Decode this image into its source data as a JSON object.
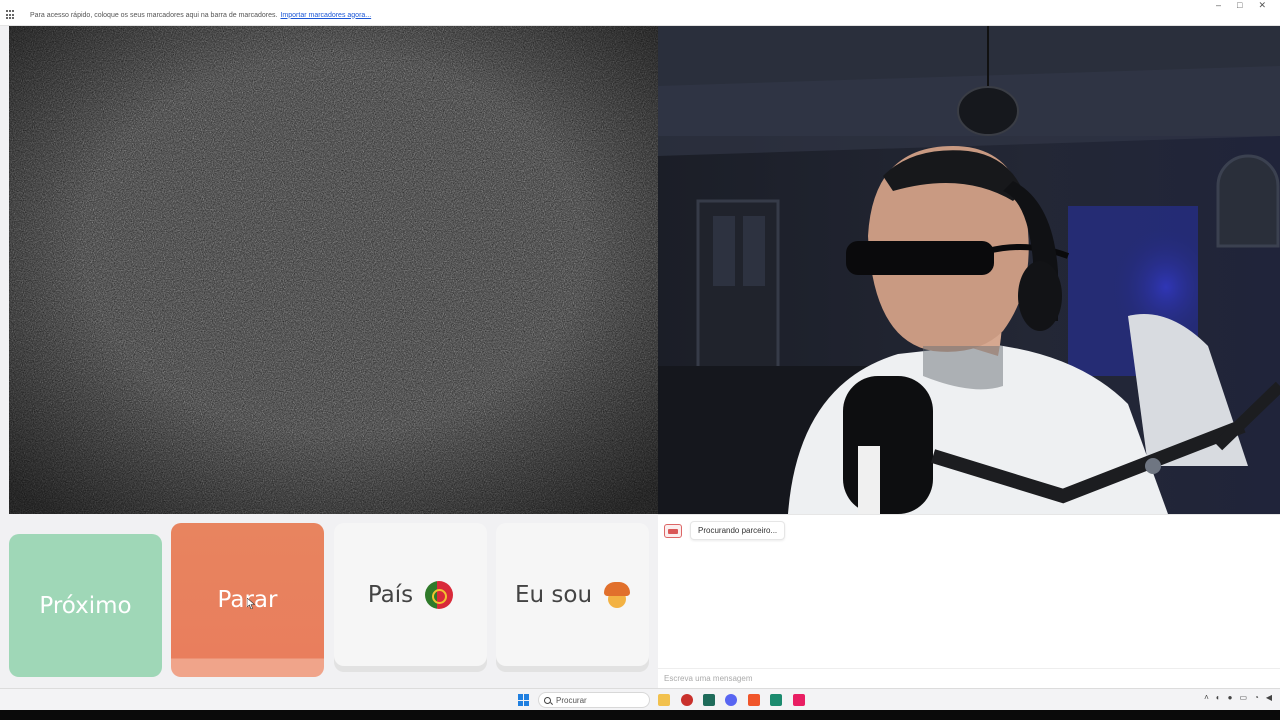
{
  "browser": {
    "bookmarks_hint": "Para acesso rápido, coloque os seus marcadores aqui na barra de marcadores.",
    "import_link": "Importar marcadores agora..."
  },
  "controls": {
    "next_label": "Próximo",
    "stop_label": "Parar",
    "country_label": "País",
    "country_flag": "portugal-flag-icon",
    "iam_label": "Eu sou",
    "iam_icon": "boy-face-icon"
  },
  "chat": {
    "status_text": "Procurando parceiro...",
    "input_placeholder": "Escreva uma mensagem"
  },
  "taskbar": {
    "search_placeholder": "Procurar"
  },
  "colors": {
    "next": "#9fd7b7",
    "stop": "#e8845f",
    "neutral_button": "#f6f6f6",
    "link": "#1a56d6"
  }
}
